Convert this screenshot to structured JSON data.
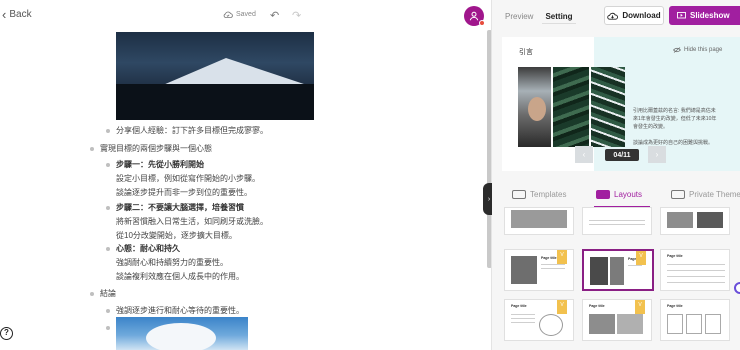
{
  "topbar": {
    "back_label": "Back",
    "saved_label": "Saved"
  },
  "document": {
    "items": [
      "分享個人經驗：訂下許多目標但完成寥寥。",
      "實現目標的兩個步驟與一個心態",
      "步驟一：先從小勝利開始",
      "設定小目標，例如從寫作開始的小步驟。",
      "談論逐步提升而非一步到位的重要性。",
      "步驟二：不要讓大腦選擇，培養習慣",
      "將新習慣融入日常生活，如同刷牙或洗臉。",
      "從10分改變開始，逐步擴大目標。",
      "心態：耐心和持久",
      "強調耐心和持續努力的重要性。",
      "談論複利效應在個人成長中的作用。",
      "結論",
      "強調逐步進行和耐心等待的重要性。"
    ]
  },
  "help_label": "?",
  "right_panel": {
    "tabs": [
      "Preview",
      "Setting"
    ],
    "download_label": "Download",
    "slideshow_label": "Slideshow",
    "preview": {
      "title": "引言",
      "hide_label": "Hide this page",
      "body_lines": [
        "引用比爾蓋茲的名言: 我們總是高估未",
        "來1年會發生的改變，但低了未來10年",
        "會發生的改變。",
        "",
        "談論成為更好的自己的困難與挑戰。"
      ],
      "counter": "04/11"
    },
    "lower_tabs": [
      "Templates",
      "Layouts",
      "Private Theme"
    ],
    "thumbs": [
      {
        "title": ""
      },
      {
        "title": ""
      },
      {
        "title": ""
      },
      {
        "title": "Page title"
      },
      {
        "title": "Page title"
      },
      {
        "title": "Page title"
      },
      {
        "title": "Page title"
      },
      {
        "title": "Page title"
      },
      {
        "title": "Page title"
      }
    ]
  },
  "colors": {
    "accent": "#a11fa0",
    "preview_bg": "#e6f6f7",
    "badge": "#f2c14e"
  }
}
